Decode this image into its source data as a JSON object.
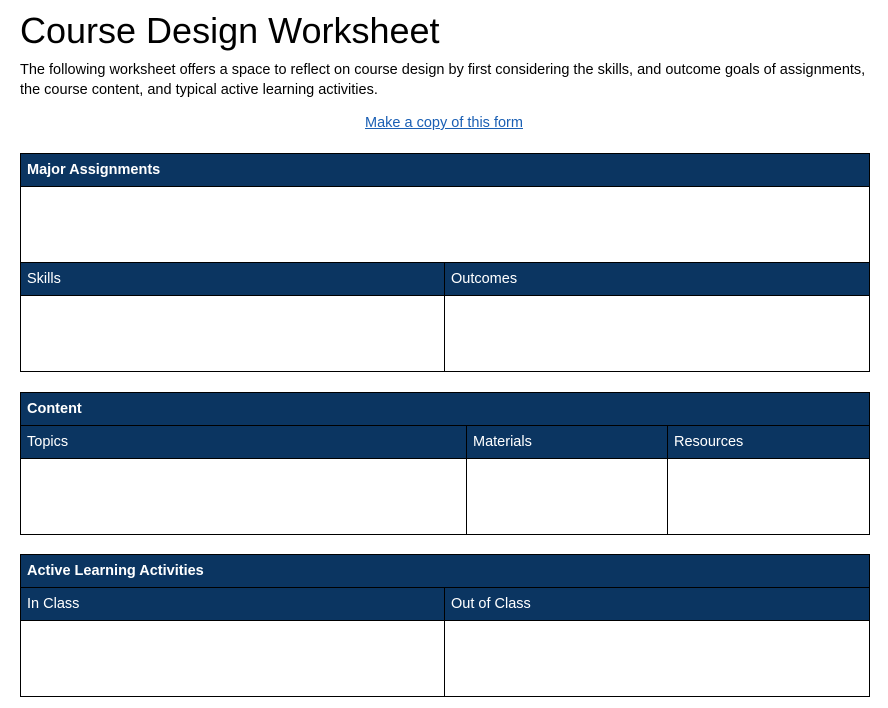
{
  "page": {
    "title": "Course Design Worksheet",
    "intro": "The following worksheet offers a space to reflect on course design by first considering the skills, and outcome goals of assignments, the course content, and typical active learning activities.",
    "copy_link": "Make a copy of this form"
  },
  "assignments": {
    "header": "Major Assignments",
    "skills_label": "Skills",
    "outcomes_label": "Outcomes"
  },
  "content": {
    "header": "Content",
    "topics_label": "Topics",
    "materials_label": "Materials",
    "resources_label": "Resources"
  },
  "activities": {
    "header": "Active Learning Activities",
    "in_class_label": "In Class",
    "out_of_class_label": "Out of Class"
  },
  "colors": {
    "header_bg": "#0b3561",
    "header_text": "#ffffff",
    "link": "#1a5fb4"
  }
}
